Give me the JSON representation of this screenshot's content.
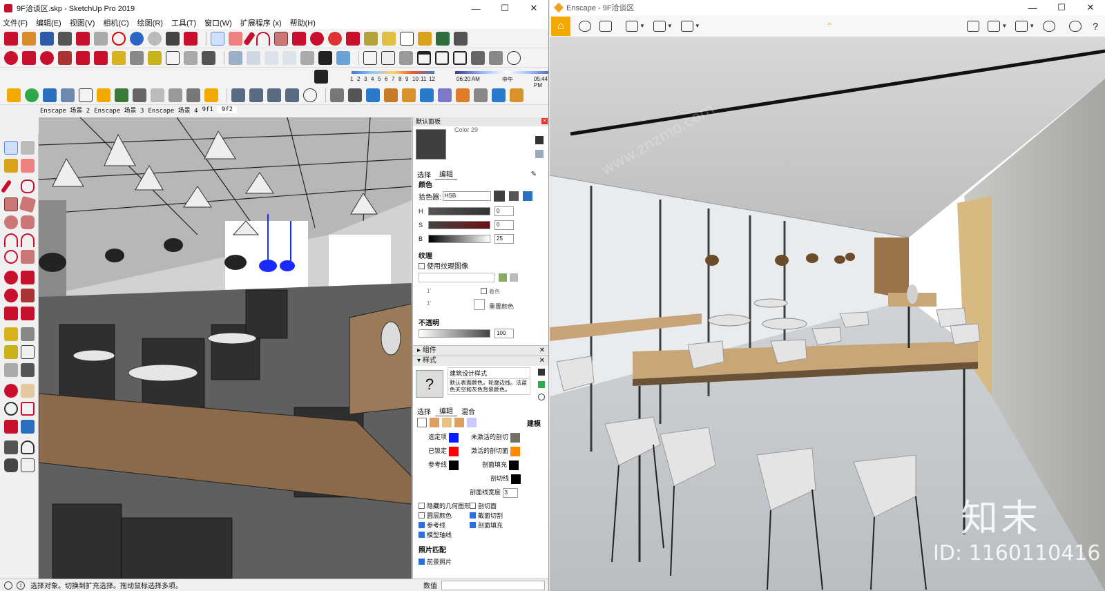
{
  "sketchup": {
    "title": "9F洽谈区.skp - SketchUp Pro 2019",
    "menu": [
      "文件(F)",
      "编辑(E)",
      "视图(V)",
      "相机(C)",
      "绘图(R)",
      "工具(T)",
      "窗口(W)",
      "扩展程序 (x)",
      "帮助(H)"
    ],
    "shadow_months": [
      "1",
      "2",
      "3",
      "4",
      "5",
      "6",
      "7",
      "8",
      "9",
      "10",
      "11",
      "12"
    ],
    "shadow_times": [
      "06:20 AM",
      "中午",
      "05:44 PM"
    ],
    "scene_tabs": [
      "Enscape 场景 2",
      "Enscape 场景 3",
      "Enscape 场景 4",
      "9f1",
      "9f2"
    ],
    "active_scene": "9f2",
    "status_text": "选择对象。切换到扩充选择。拖动鼠标选择多项。",
    "measurements_label": "数值"
  },
  "tray": {
    "title": "默认面板",
    "material_name_partial": "Color 29",
    "tabs": [
      "选择",
      "编辑"
    ],
    "color_heading": "颜色",
    "picker_label": "拾色器:",
    "picker_value": "HSB",
    "hsb": [
      {
        "label": "H",
        "value": "0"
      },
      {
        "label": "S",
        "value": "0"
      },
      {
        "label": "B",
        "value": "25"
      }
    ],
    "texture_heading": "纹理",
    "use_texture": "使用纹理图像",
    "tex_w": "1'",
    "tex_h": "1'",
    "colorize": "着色",
    "reset_color": "重置颜色",
    "opacity_heading": "不透明",
    "opacity_value": "100",
    "components_label": "组件",
    "styles_label": "样式",
    "style_name": "建筑设计样式",
    "style_desc": "默认表面颜色。轮廓边线。法蓝色天空和灰色背景颜色。",
    "style_tabs": [
      "选择",
      "编辑",
      "混合"
    ],
    "style_mode": "建模",
    "colors_left": [
      {
        "label": "选定项",
        "color": "#0a1cff"
      },
      {
        "label": "已锁定",
        "color": "#ff0000"
      },
      {
        "label": "参考线",
        "color": "#000000"
      }
    ],
    "colors_right": [
      {
        "label": "未激活的剖切",
        "color": "#777066"
      },
      {
        "label": "激活的剖切面",
        "color": "#ff8a00"
      },
      {
        "label": "剖面填充",
        "color": "#000000"
      },
      {
        "label": "剖切线",
        "color": "#000000"
      }
    ],
    "section_width_label": "剖面线宽度",
    "section_width_value": "3",
    "checks": [
      {
        "label": "隐藏的几何图形",
        "on": false
      },
      {
        "label": "剖切面",
        "on": false
      },
      {
        "label": "圆层颜色",
        "on": false
      },
      {
        "label": "截面切割",
        "on": true
      },
      {
        "label": "参考线",
        "on": true
      },
      {
        "label": "剖面填充",
        "on": true
      },
      {
        "label": "模型轴线",
        "on": true
      }
    ],
    "photo_heading": "照片匹配",
    "photo_fg": "前景照片"
  },
  "enscape": {
    "title": "Enscape - 9F洽谈区"
  },
  "watermark": {
    "brand": "知末",
    "id": "ID: 1160110416",
    "site": "www.znzmo.com"
  },
  "colors": {
    "accent_orange": "#f2a900",
    "sketchup_red": "#c8102e",
    "select_blue": "#0a1cff"
  }
}
